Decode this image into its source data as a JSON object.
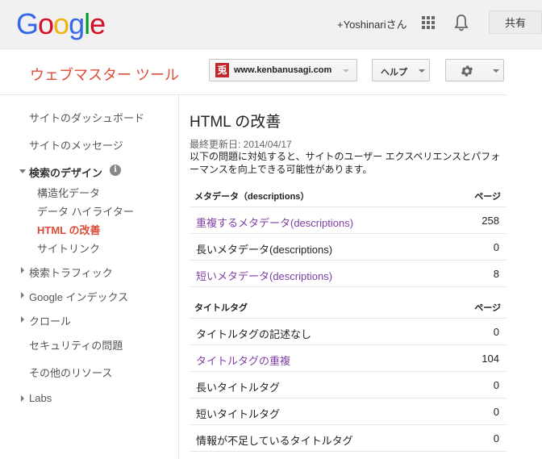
{
  "header": {
    "logo": [
      "G",
      "o",
      "o",
      "g",
      "l",
      "e"
    ],
    "logo_colors": [
      "#3369e8",
      "#d50f25",
      "#eeb211",
      "#3369e8",
      "#009925",
      "#d50f25"
    ],
    "user_name": "+Yoshinariさん",
    "share_label": "共有",
    "icons": [
      "apps-grid-icon",
      "bell-icon"
    ]
  },
  "toolbar": {
    "product_title": "ウェブマスター ツール",
    "site_favicon_char": "兎",
    "site_label": "www.kenbanusagi.com",
    "help_label": "ヘルプ",
    "settings_icon": "gear-icon"
  },
  "sidebar": {
    "items": [
      {
        "label": "サイトのダッシュボード"
      },
      {
        "label": "サイトのメッセージ"
      },
      {
        "label": "検索のデザイン"
      },
      {
        "label": "構造化データ"
      },
      {
        "label": "データ ハイライター"
      },
      {
        "label": "HTML の改善"
      },
      {
        "label": "サイトリンク"
      },
      {
        "label": "検索トラフィック"
      },
      {
        "label": "Google インデックス"
      },
      {
        "label": "クロール"
      },
      {
        "label": "セキュリティの問題"
      },
      {
        "label": "その他のリソース"
      },
      {
        "label": "Labs"
      }
    ],
    "info_char": "i",
    "active_color": "#dd4b39"
  },
  "main": {
    "title": "HTML の改善",
    "last_updated": "最終更新日: 2014/04/17",
    "description": "以下の問題に対処すると、サイトのユーザー エクスペリエンスとパフォーマンスを向上できる可能性があります。",
    "meta_section": {
      "header": "メタデータ（descriptions）",
      "pages_header": "ページ",
      "rows": [
        {
          "label": "重複するメタデータ(descriptions)",
          "value": "258"
        },
        {
          "label": "長いメタデータ(descriptions)",
          "value": "0"
        },
        {
          "label": "短いメタデータ(descriptions)",
          "value": "8"
        }
      ]
    },
    "title_section": {
      "header": "タイトルタグ",
      "pages_header": "ページ",
      "rows": [
        {
          "label": "タイトルタグの記述なし",
          "value": "0"
        },
        {
          "label": "タイトルタグの重複",
          "value": "104"
        },
        {
          "label": "長いタイトルタグ",
          "value": "0"
        },
        {
          "label": "短いタイトルタグ",
          "value": "0"
        },
        {
          "label": "情報が不足しているタイトルタグ",
          "value": "0"
        }
      ]
    }
  }
}
